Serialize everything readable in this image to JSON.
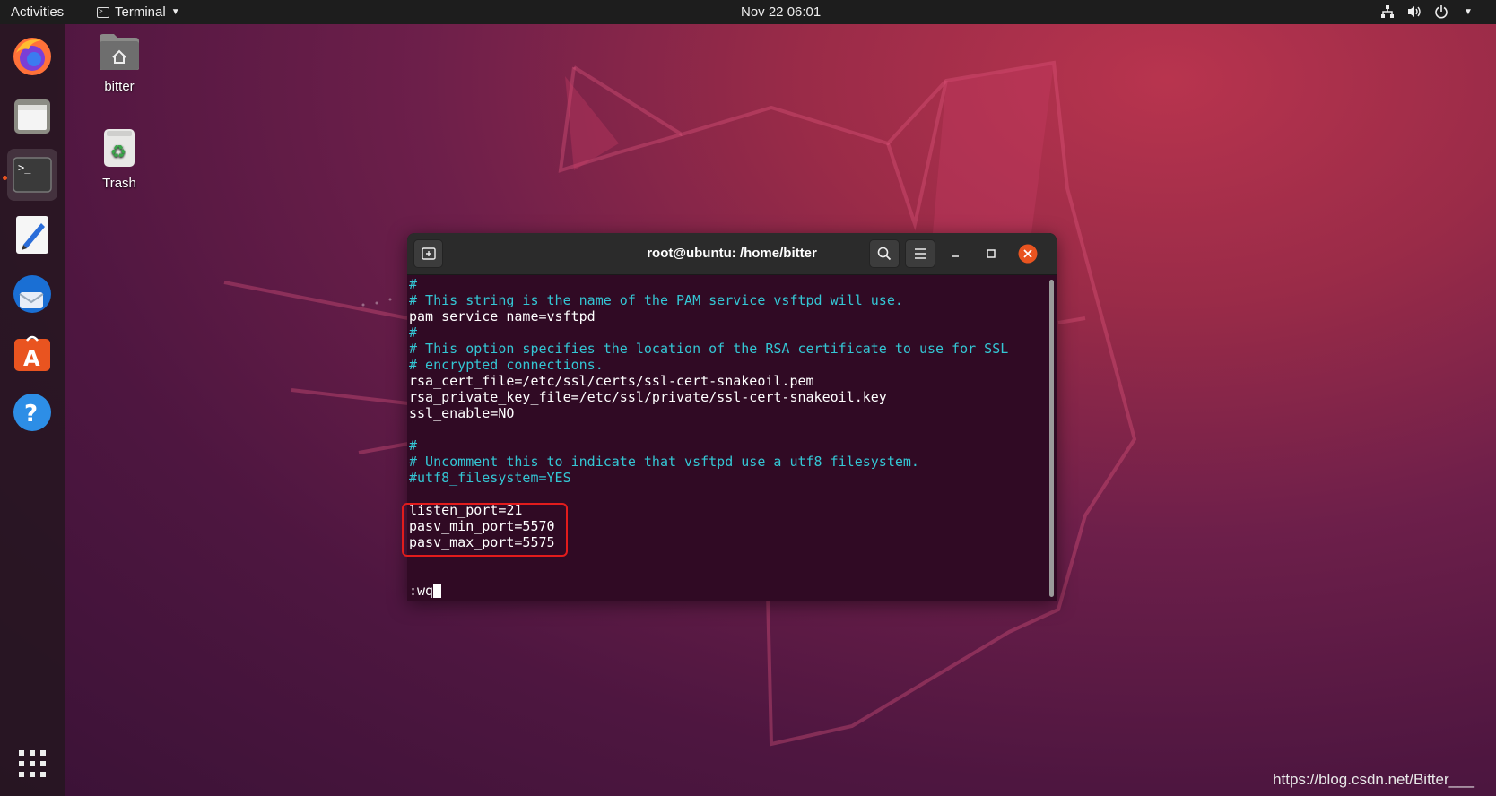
{
  "topbar": {
    "activities": "Activities",
    "app_name": "Terminal",
    "clock": "Nov 22  06:01",
    "tray_icons": [
      "network-icon",
      "volume-icon",
      "power-icon",
      "chevron-down-icon"
    ]
  },
  "dock": {
    "items": [
      {
        "name": "firefox",
        "icon": "firefox-icon"
      },
      {
        "name": "files",
        "icon": "files-icon"
      },
      {
        "name": "terminal",
        "icon": "terminal-icon",
        "active": true
      },
      {
        "name": "text-editor",
        "icon": "text-editor-icon"
      },
      {
        "name": "thunderbird",
        "icon": "thunderbird-icon"
      },
      {
        "name": "ubuntu-software",
        "icon": "software-icon"
      },
      {
        "name": "help",
        "icon": "help-icon"
      }
    ],
    "show_apps_icon": "app-grid-icon"
  },
  "desktop": {
    "home_label": "bitter",
    "trash_label": "Trash"
  },
  "terminal": {
    "title": "root@ubuntu: /home/bitter",
    "lines": [
      {
        "text": "#",
        "type": "comment"
      },
      {
        "text": "# This string is the name of the PAM service vsftpd will use.",
        "type": "comment"
      },
      {
        "text": "pam_service_name=vsftpd",
        "type": "plain"
      },
      {
        "text": "#",
        "type": "comment"
      },
      {
        "text": "# This option specifies the location of the RSA certificate to use for SSL",
        "type": "comment"
      },
      {
        "text": "# encrypted connections.",
        "type": "comment"
      },
      {
        "text": "rsa_cert_file=/etc/ssl/certs/ssl-cert-snakeoil.pem",
        "type": "plain"
      },
      {
        "text": "rsa_private_key_file=/etc/ssl/private/ssl-cert-snakeoil.key",
        "type": "plain"
      },
      {
        "text": "ssl_enable=NO",
        "type": "plain"
      },
      {
        "text": "",
        "type": "plain"
      },
      {
        "text": "#",
        "type": "comment"
      },
      {
        "text": "# Uncomment this to indicate that vsftpd use a utf8 filesystem.",
        "type": "comment"
      },
      {
        "text": "#utf8_filesystem=YES",
        "type": "comment"
      },
      {
        "text": "",
        "type": "plain"
      },
      {
        "text": "listen_port=21",
        "type": "plain"
      },
      {
        "text": "pasv_min_port=5570",
        "type": "plain"
      },
      {
        "text": "pasv_max_port=5575",
        "type": "plain"
      },
      {
        "text": "",
        "type": "plain"
      },
      {
        "text": "",
        "type": "plain"
      }
    ],
    "command": ":wq"
  },
  "colors": {
    "comment": "#34c6d4",
    "terminal_bg": "#300a24",
    "highlight": "#e21c1c",
    "accent": "#e95420"
  },
  "watermark": "https://blog.csdn.net/Bitter___"
}
